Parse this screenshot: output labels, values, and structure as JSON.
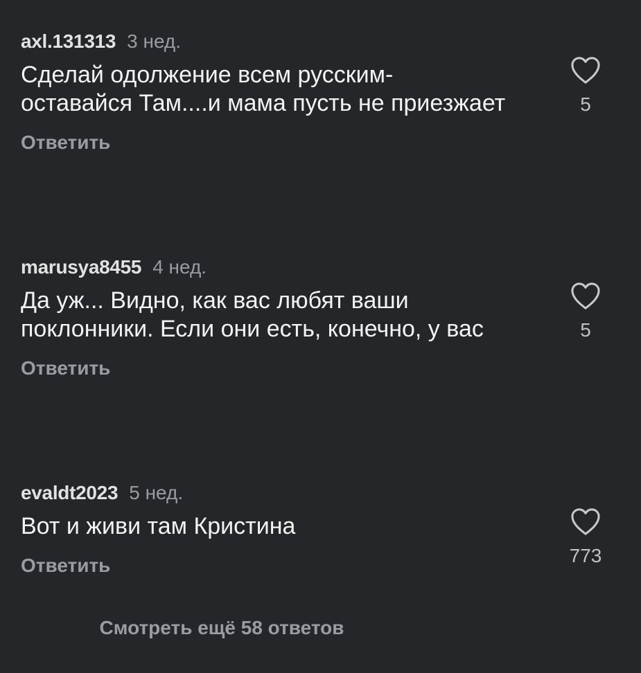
{
  "comments": [
    {
      "username": "axl.131313",
      "time": "3 нед.",
      "text": "Сделай одолжение всем русским- оставайся Там....и мама пусть не приезжает",
      "reply_label": "Ответить",
      "likes": "5",
      "like_icon": "heart-outline-icon"
    },
    {
      "username": "marusya8455",
      "time": "4 нед.",
      "text": "Да уж... Видно, как вас любят ваши поклонники. Если они есть, конечно, у вас",
      "reply_label": "Ответить",
      "likes": "5",
      "like_icon": "heart-outline-icon"
    },
    {
      "username": "evaldt2023",
      "time": "5 нед.",
      "text": "Вот и живи там Кристина",
      "reply_label": "Ответить",
      "likes": "773",
      "like_icon": "heart-outline-icon"
    }
  ],
  "view_more_label": "Смотреть ещё 58 ответов",
  "colors": {
    "background": "#25262a",
    "primary_text": "#f3f3f3",
    "secondary_text": "#9a9ca1"
  }
}
